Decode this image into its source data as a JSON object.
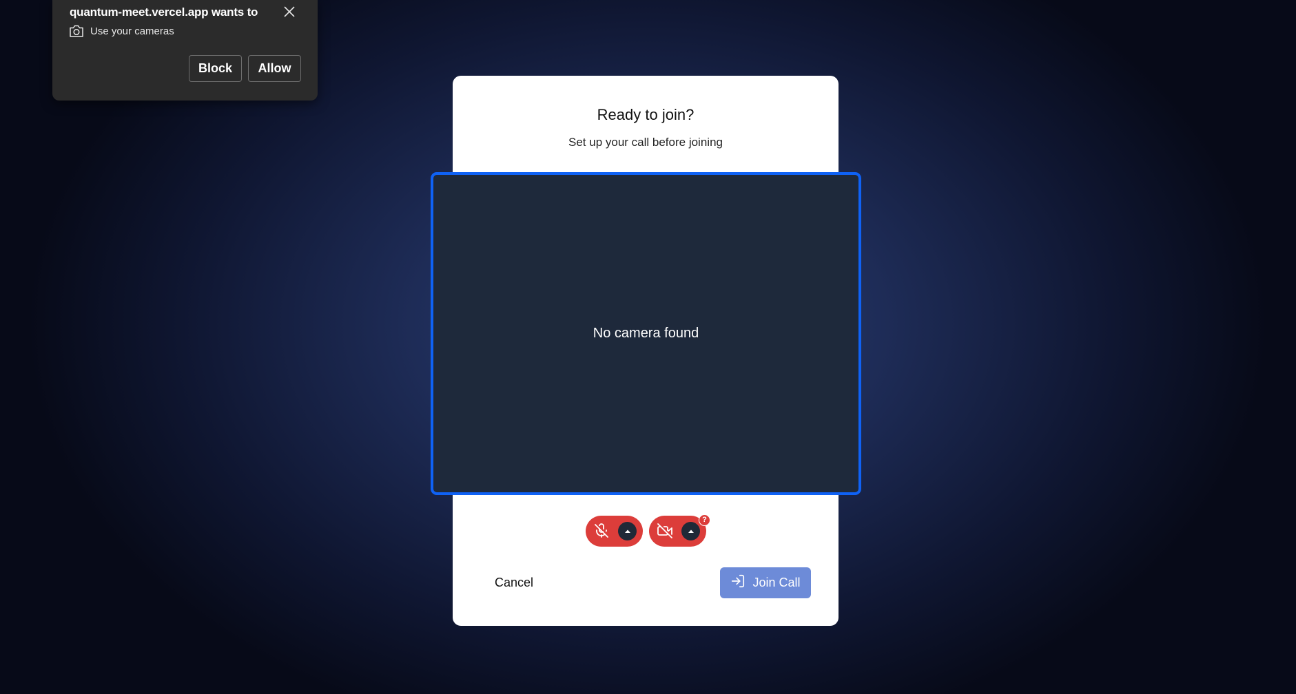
{
  "permission_prompt": {
    "title": "quantum-meet.vercel.app wants to",
    "permission_label": "Use your cameras",
    "permission_icon": "camera-icon",
    "block_label": "Block",
    "allow_label": "Allow"
  },
  "prejoin": {
    "title": "Ready to join?",
    "subtitle": "Set up your call before joining",
    "video_message": "No camera found",
    "mic_toggle": {
      "icon": "mic-off-icon",
      "state": "off",
      "color": "#dc3d3a"
    },
    "camera_toggle": {
      "icon": "video-off-icon",
      "state": "off",
      "color": "#dc3d3a"
    },
    "camera_badge": "?",
    "cancel_label": "Cancel",
    "join_label": "Join Call",
    "join_icon": "sign-in-icon"
  },
  "colors": {
    "accent_border": "#0f62f5",
    "join_button": "#6d8bd8",
    "toggle_red": "#dc3d3a",
    "video_bg": "#1e293b"
  }
}
